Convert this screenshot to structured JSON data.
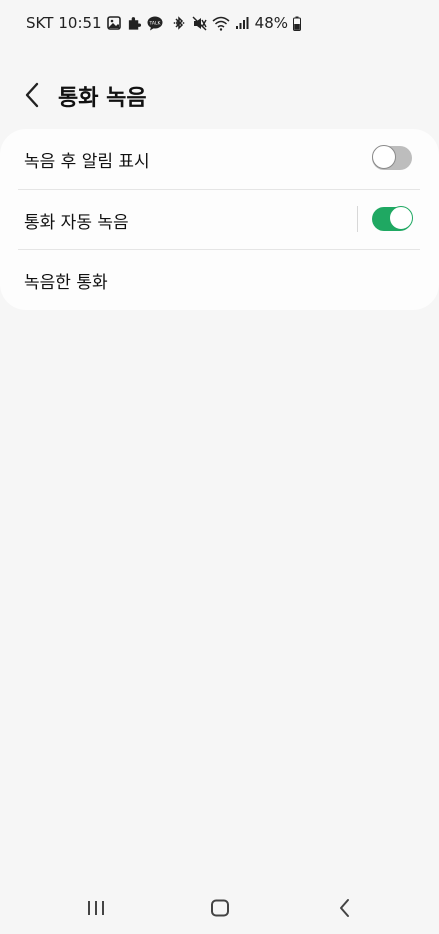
{
  "status_bar": {
    "carrier": "SKT",
    "time": "10:51",
    "battery": "48%",
    "icons": [
      "gallery-icon",
      "puzzle-icon",
      "talk-icon",
      "bluetooth-icon",
      "mute-icon",
      "wifi-icon",
      "signal-icon",
      "battery-icon"
    ],
    "talk_label": "TALK"
  },
  "header": {
    "title": "통화 녹음",
    "back_icon": "back-arrow-icon"
  },
  "settings": {
    "items": [
      {
        "label": "녹음 후 알림 표시",
        "toggle": "off"
      },
      {
        "label": "통화 자동 녹음",
        "toggle": "on"
      },
      {
        "label": "녹음한 통화"
      }
    ]
  },
  "navbar": {
    "icons": [
      "recent-apps-icon",
      "home-icon",
      "back-icon"
    ]
  },
  "colors": {
    "background": "#f6f6f6",
    "card": "#fdfdfd",
    "accent_green": "#1fa862"
  }
}
